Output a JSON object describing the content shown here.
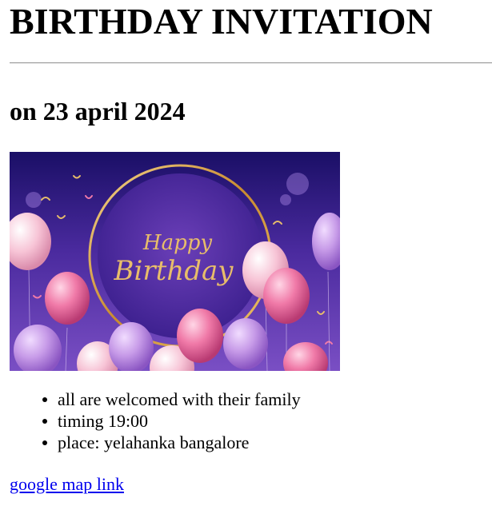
{
  "heading": "BIRTHDAY INVITATION",
  "date_heading": "on 23 april 2024",
  "banner": {
    "script_line1": "Happy",
    "script_line2": "Birthday"
  },
  "details": [
    "all are welcomed with their family",
    "timing 19:00",
    "place: yelahanka bangalore"
  ],
  "map_link": "google map link",
  "colors": {
    "link": "#0000ee",
    "banner_bg": "#4a2a9e",
    "gold": "#d9a548",
    "balloon_pink": "#f07aa8",
    "balloon_lilac": "#c79be8"
  }
}
